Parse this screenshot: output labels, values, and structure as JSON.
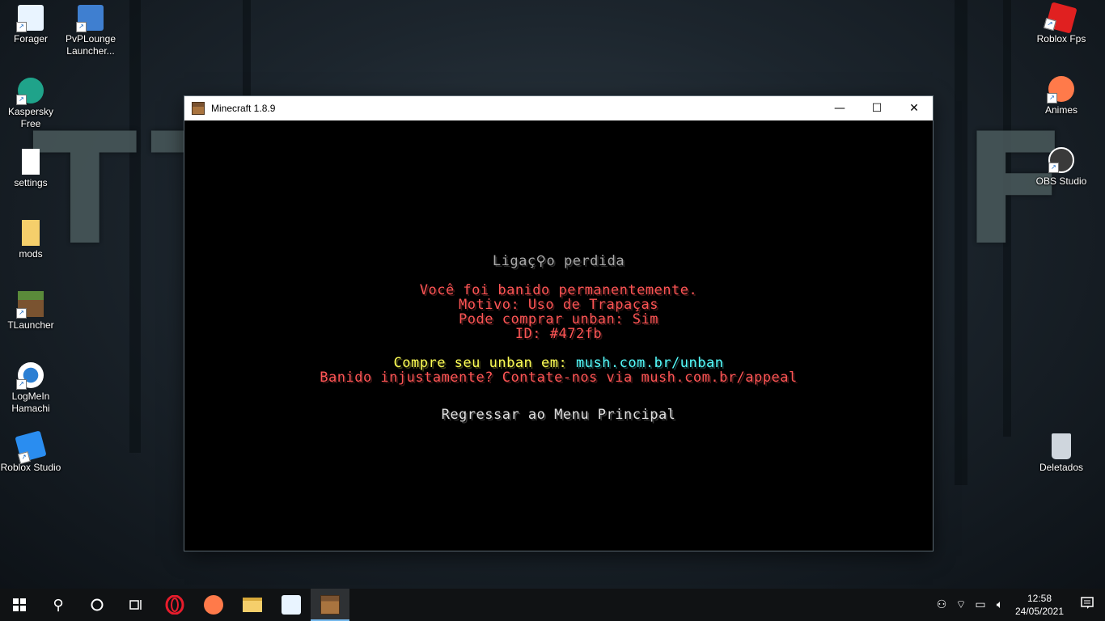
{
  "desktop": {
    "background_letters": [
      "T",
      "T",
      "F"
    ],
    "left_icons": [
      {
        "label": "Forager",
        "icon": "forager-icon",
        "color": "#e9f4ff"
      },
      {
        "label": "PvPLounge Launcher...",
        "icon": "pvplounge-icon",
        "color": "#3f7fd0"
      },
      {
        "label": "Kaspersky Free",
        "icon": "kaspersky-icon",
        "color": "#1fa38a"
      },
      {
        "label": "settings",
        "icon": "file-icon",
        "color": "#ffffff"
      },
      {
        "label": "mods",
        "icon": "folder-icon",
        "color": "#f5cf6b"
      },
      {
        "label": "TLauncher",
        "icon": "tlauncher-icon",
        "color": "#5a8a3a"
      },
      {
        "label": "LogMeIn Hamachi",
        "icon": "hamachi-icon",
        "color": "#ffffff"
      },
      {
        "label": "Roblox Studio",
        "icon": "roblox-studio-icon",
        "color": "#2a8df0"
      }
    ],
    "right_icons": [
      {
        "label": "Roblox Fps",
        "icon": "roblox-icon",
        "color": "#e02020"
      },
      {
        "label": "Animes",
        "icon": "animes-icon",
        "color": "#ff7a4a"
      },
      {
        "label": "OBS Studio",
        "icon": "obs-icon",
        "color": "#3a3a3a"
      },
      {
        "label": "Deletados",
        "icon": "recycle-bin-icon",
        "color": "#cfd6dd"
      }
    ]
  },
  "window": {
    "title": "Minecraft 1.8.9",
    "minimize_glyph": "—",
    "maximize_glyph": "☐",
    "close_glyph": "✕"
  },
  "disconnect": {
    "heading": "Ligaç⚲o perdida",
    "line1": "Você foi banido permanentemente.",
    "line2": "Motivo: Uso de Trapaças",
    "line3": "Pode comprar unban: Sim",
    "line4": "ID: #472fb",
    "buy_prefix": "Compre seu unban em: ",
    "buy_link": "mush.com.br/unban",
    "appeal": "Banido injustamente? Contate-nos via mush.com.br/appeal",
    "back_button": "Regressar ao Menu Principal"
  },
  "taskbar": {
    "clock_time": "12:58",
    "clock_date": "24/05/2021",
    "colors": {
      "accent": "#76b9ed",
      "red": "#ff5555",
      "yellow": "#ffff55",
      "aqua": "#55ffff",
      "gray": "#aaaaaa"
    }
  }
}
